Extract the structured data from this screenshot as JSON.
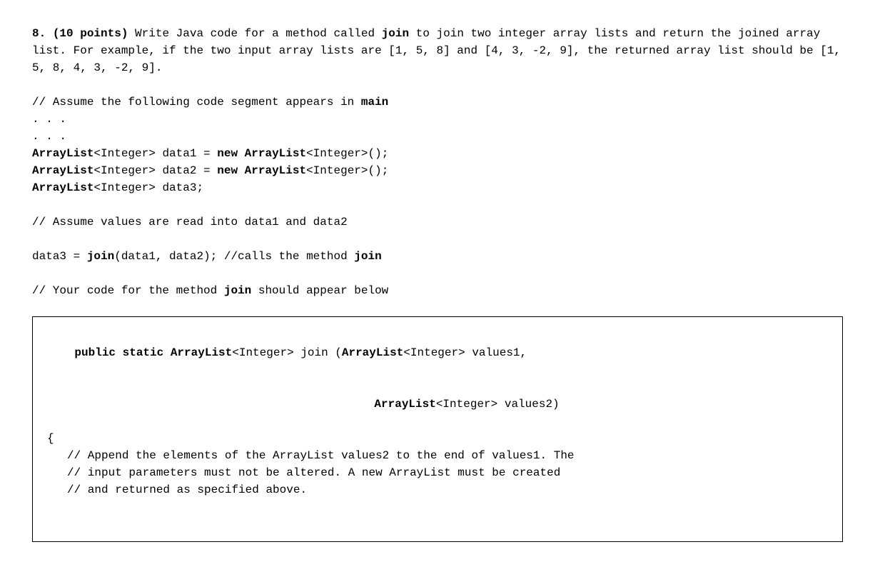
{
  "question": {
    "number": "8.",
    "points": "(10 points)",
    "text_part1": " Write Java code for a method called ",
    "method_name": "join",
    "text_part2": " to join two integer array lists and return the joined array list. For example, if the two input array lists are [1, 5, 8] and [4, 3, -2, 9], the returned array list should be [1, 5, 8, 4, 3, -2, 9]."
  },
  "comment_main_prefix": "// Assume the following code segment appears in ",
  "comment_main_bold": "main",
  "dots": ". . .",
  "decl1": {
    "type": "ArrayList",
    "generic": "<Integer> data1 = ",
    "new_kw": "new ArrayList",
    "tail": "<Integer>();"
  },
  "decl2": {
    "type": "ArrayList",
    "generic": "<Integer> data2 = ",
    "new_kw": "new ArrayList",
    "tail": "<Integer>();"
  },
  "decl3": {
    "type": "ArrayList",
    "generic": "<Integer> data3;"
  },
  "comment_values": "// Assume values are read into data1 and data2",
  "call_line": {
    "prefix": "data3 = ",
    "call": "join",
    "suffix": "(data1, data2); //calls the method ",
    "trailing_bold": "join"
  },
  "comment_your_code_prefix": "// Your code for the method ",
  "comment_your_code_bold": "join",
  "comment_your_code_suffix": " should appear below",
  "method_box": {
    "sig1_part1": "public static ArrayList",
    "sig1_part2": "<Integer> join (",
    "sig1_part3": "ArrayList",
    "sig1_part4": "<Integer> values1,",
    "sig2_part1": "ArrayList",
    "sig2_part2": "<Integer> values2)",
    "brace": "{",
    "c1": "// Append the elements of the ArrayList values2 to the end of values1. The",
    "c2": "// input parameters must not be altered. A new ArrayList must be created",
    "c3": "// and returned as specified above."
  }
}
